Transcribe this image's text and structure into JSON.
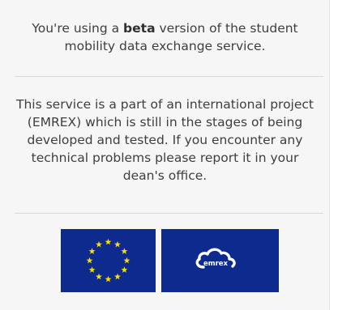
{
  "beta_notice": {
    "prefix": "You're using a ",
    "emphasis": "beta",
    "suffix": " version of the student mobility data exchange service."
  },
  "project_notice": {
    "text": "This service is a part of an international project (EMREX) which is still in the stages of being developed and tested. If you encounter any technical problems please report it in your dean's office."
  },
  "logos": {
    "eu_flag": {
      "icon": "eu-flag-icon",
      "background": "#0d2b8e",
      "star_color": "#ffdd00"
    },
    "emrex": {
      "icon": "emrex-cloud-icon",
      "background": "#0d2b8e",
      "label": "emrex"
    }
  }
}
